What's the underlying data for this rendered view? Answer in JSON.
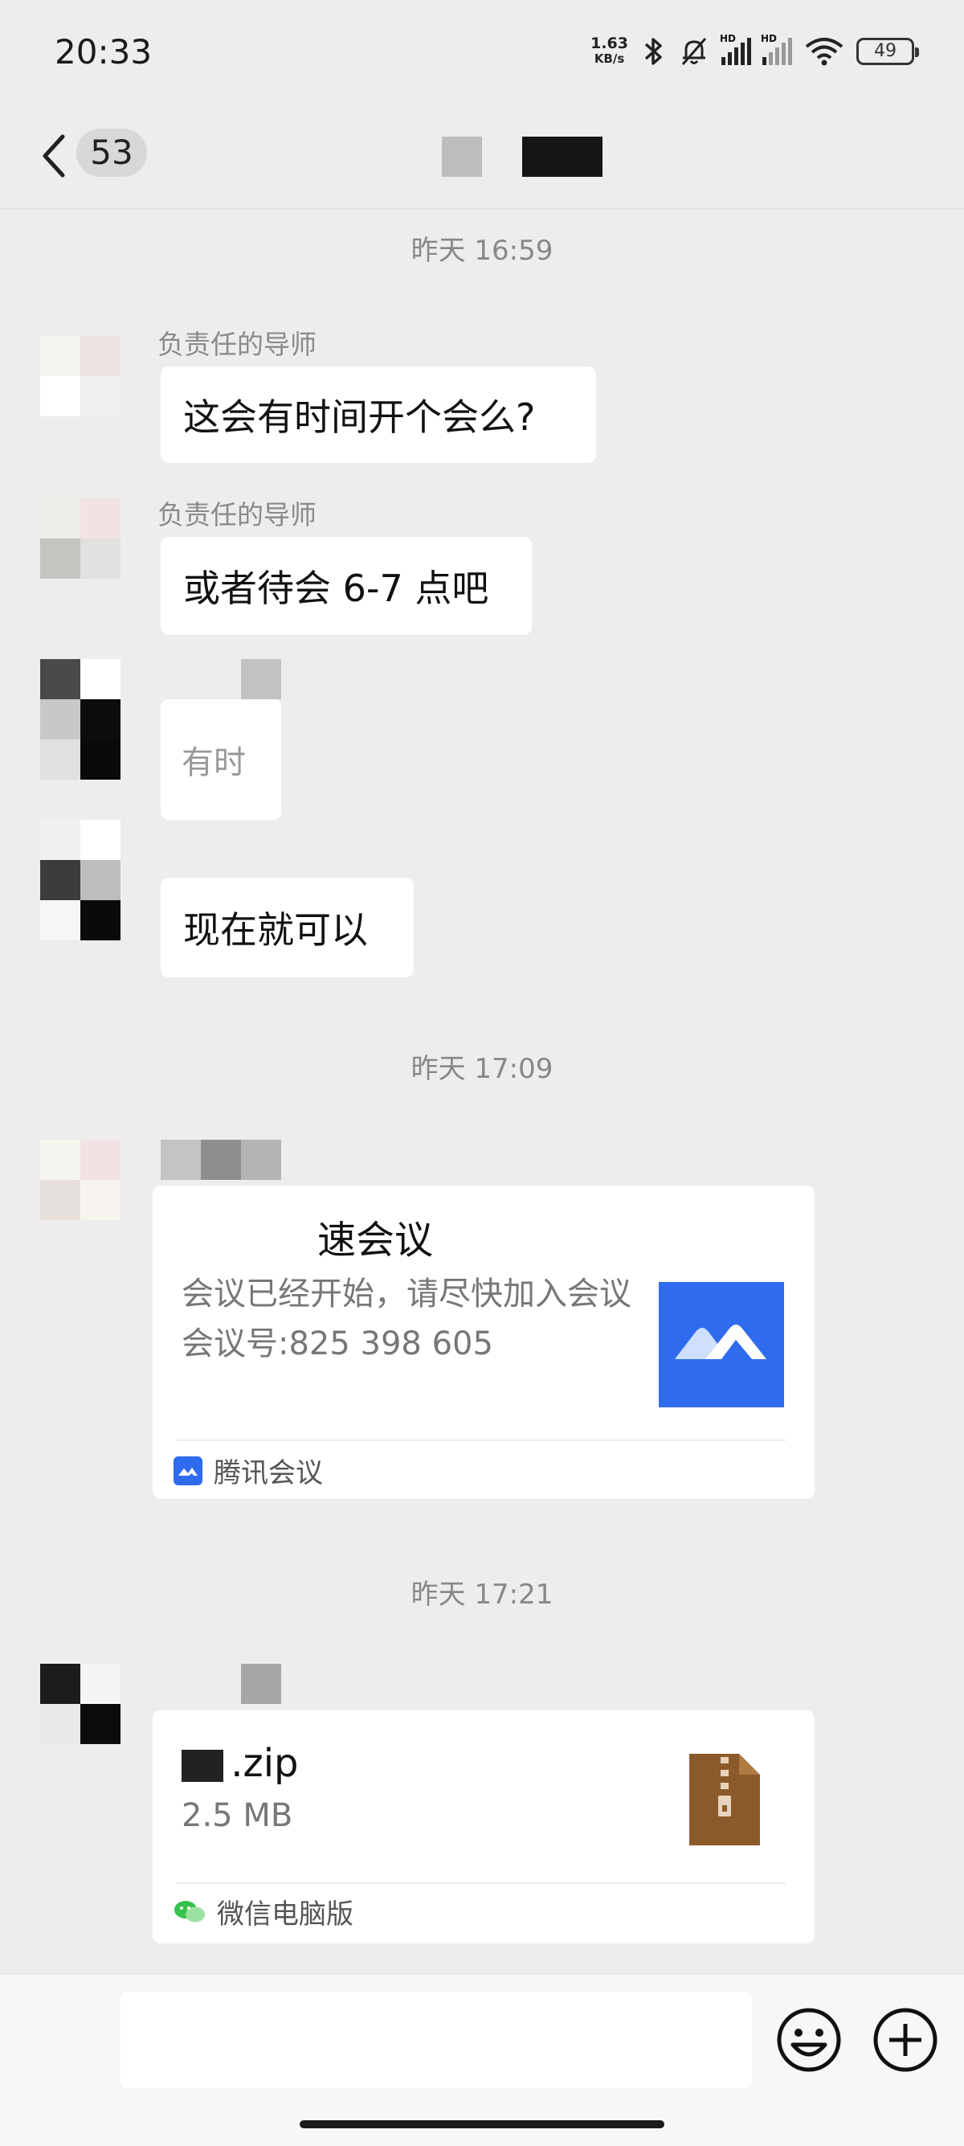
{
  "status_bar": {
    "time": "20:33",
    "net_speed_value": "1.63",
    "net_speed_unit": "KB/s",
    "signal1_label": "HD",
    "signal2_label": "HD",
    "battery": "49"
  },
  "header": {
    "unread_count": "53"
  },
  "messages": {
    "ts1": "昨天 16:59",
    "m1_sender": "负责任的导师",
    "m1_text": "这会有时间开个会么?",
    "m2_sender": "负责任的导师",
    "m2_text": "或者待会 6-7 点吧",
    "m3_text": "有时",
    "m4_text": "现在就可以",
    "ts2": "昨天 17:09",
    "card_title": "速会议",
    "card_desc": "会议已经开始，请尽快加入会议",
    "card_meeting": "会议号:825 398 605",
    "card_source": "腾讯会议",
    "ts3": "昨天 17:21",
    "file_name": ".zip",
    "file_size": "2.5 MB",
    "file_source": "微信电脑版"
  },
  "colors": {
    "background": "#ededed",
    "bubble": "#ffffff",
    "meeting_brand": "#2f6bef",
    "zip_icon": "#8b5a2b",
    "wechat_green": "#35c24e"
  },
  "icons": [
    "back-arrow-icon",
    "bluetooth-icon",
    "mute-bell-icon",
    "wifi-icon",
    "tencent-meeting-logo-icon",
    "zip-file-icon",
    "wechat-icon",
    "emoji-icon",
    "plus-icon"
  ]
}
